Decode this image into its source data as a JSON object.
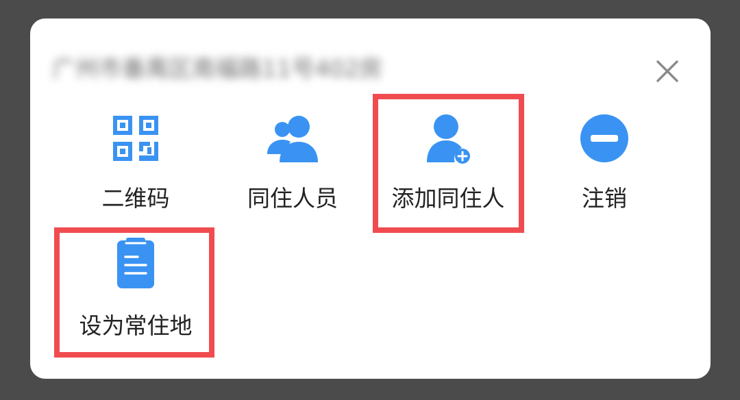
{
  "colors": {
    "overlay": "#4b4b4b",
    "sheet": "#ffffff",
    "icon_blue": "#3a93f2",
    "label_text": "#222222",
    "highlight": "#f04c50",
    "close_icon": "#8a8a8a"
  },
  "header": {
    "address": "广州市番禺区南福路11号402房",
    "close_icon": "close-icon"
  },
  "actions": [
    {
      "label": "二维码",
      "icon": "qr-code-icon"
    },
    {
      "label": "同住人员",
      "icon": "people-icon"
    },
    {
      "label": "添加同住人",
      "icon": "add-person-icon"
    },
    {
      "label": "注销",
      "icon": "cancel-icon"
    },
    {
      "label": "设为常住地",
      "icon": "clipboard-icon"
    }
  ]
}
